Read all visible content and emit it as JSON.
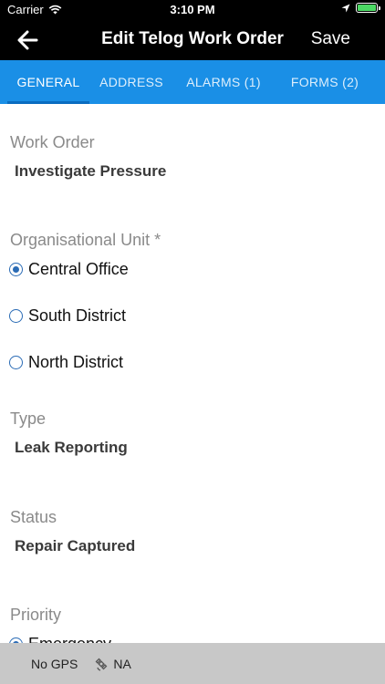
{
  "status_bar": {
    "carrier": "Carrier",
    "time": "3:10 PM"
  },
  "header": {
    "title": "Edit Telog Work Order",
    "save_label": "Save"
  },
  "tabs": [
    {
      "label": "GENERAL",
      "active": true
    },
    {
      "label": "ADDRESS",
      "active": false
    },
    {
      "label": "ALARMS (1)",
      "active": false
    },
    {
      "label": "FORMS (2)",
      "active": false
    }
  ],
  "form": {
    "work_order": {
      "label": "Work Order",
      "value": "Investigate Pressure"
    },
    "org_unit": {
      "label": "Organisational Unit *",
      "options": [
        {
          "label": "Central Office",
          "selected": true
        },
        {
          "label": "South District",
          "selected": false
        },
        {
          "label": "North District",
          "selected": false
        }
      ]
    },
    "type": {
      "label": "Type",
      "value": "Leak Reporting"
    },
    "status": {
      "label": "Status",
      "value": "Repair Captured"
    },
    "priority": {
      "label": "Priority",
      "options": [
        {
          "label": "Emergency",
          "selected": true
        }
      ]
    }
  },
  "bottom_bar": {
    "gps": "No GPS",
    "network": "NA"
  },
  "colors": {
    "tab_bar": "#1a8fe6",
    "radio": "#2a6bb5",
    "header": "#000000",
    "bottom_bar": "#c8c8c8"
  }
}
